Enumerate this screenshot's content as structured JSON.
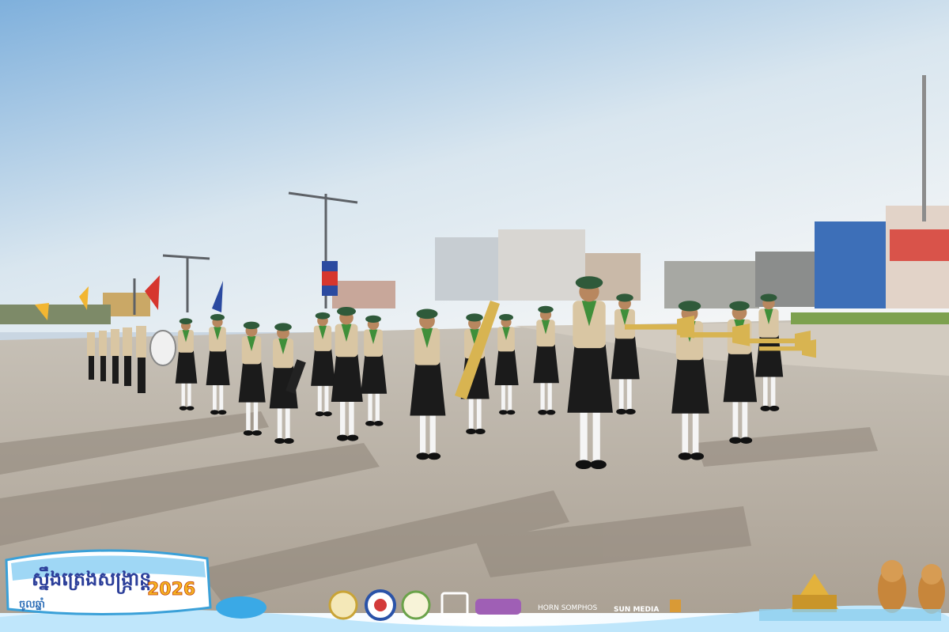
{
  "photo": {
    "subject": "scout marching band parade",
    "colors": {
      "sky_top": "#8fb8dc",
      "sky_bottom": "#eef2f4",
      "road": "#b7ada0",
      "uniform_shirt": "#d9c6a3",
      "skirt": "#1b1b1b",
      "beret": "#2f5a3a",
      "scarf": "#3f8f3a",
      "brass": "#d8b451"
    }
  },
  "festival_logo": {
    "title_khmer": "ស្នឹងត្រេងសង្ក្រាន្ត",
    "year": "2026",
    "subtitle_khmer": "ចូលឆ្នាំ",
    "icon": "festival-emblem-icon"
  },
  "sponsors": {
    "items": [
      {
        "name": "seal-1-icon"
      },
      {
        "name": "seal-2-icon"
      },
      {
        "name": "seal-3-icon"
      },
      {
        "name": "camera-logo-icon"
      },
      {
        "name": "sangkran-logo-icon"
      }
    ],
    "horn_label": "HORN SOMPHOS",
    "sun_label": "SUN MEDIA"
  },
  "mascots": {
    "icon": "zodiac-mascot-icon",
    "temple_icon": "temple-icon"
  }
}
